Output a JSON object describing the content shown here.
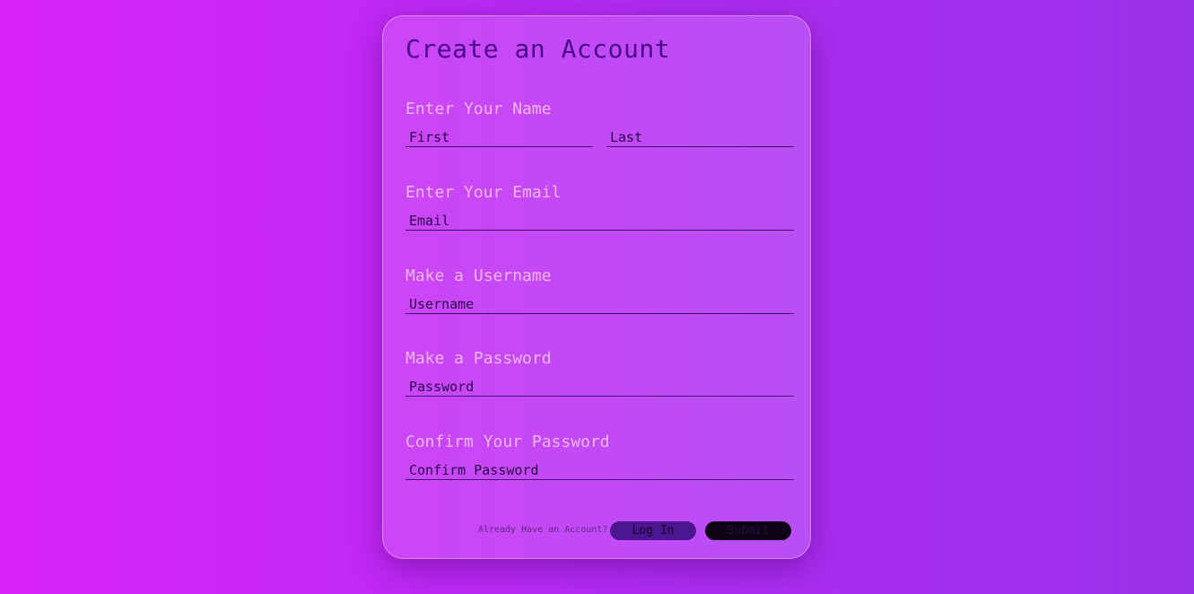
{
  "form": {
    "title": "Create an Account",
    "name_label": "Enter Your Name",
    "first_placeholder": "First",
    "last_placeholder": "Last",
    "email_label": "Enter Your Email",
    "email_placeholder": "Email",
    "username_label": "Make a Username",
    "username_placeholder": "Username",
    "password_label": "Make a Password",
    "password_placeholder": "Password",
    "confirm_label": "Confirm Your Password",
    "confirm_placeholder": "Confirm Password"
  },
  "footer": {
    "prompt": "Already Have an Account?",
    "login_label": "Log In",
    "submit_label": "Submit"
  },
  "colors": {
    "background_start": "#d923fa",
    "background_end": "#9a30e8",
    "title": "#4a0a8c",
    "label": "#ecb6f6",
    "login_button": "#4b1690",
    "submit_button": "#0e0216"
  }
}
